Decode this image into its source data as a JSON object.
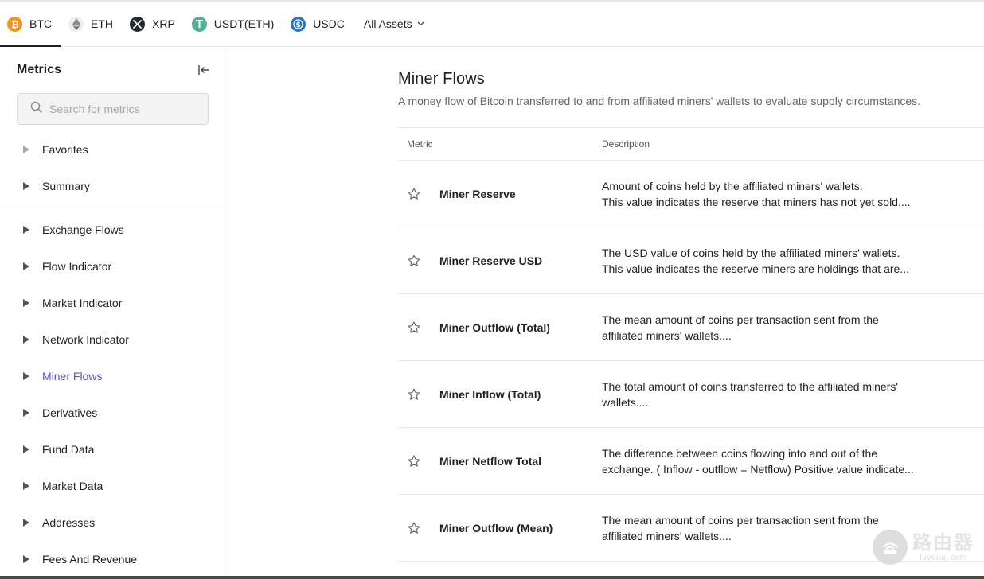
{
  "assets": [
    {
      "symbol": "BTC",
      "icon": "bitcoin-icon",
      "color": "#f7931a"
    },
    {
      "symbol": "ETH",
      "icon": "ethereum-icon",
      "color": "#8c8c8c"
    },
    {
      "symbol": "XRP",
      "icon": "xrp-icon",
      "color": "#23292f"
    },
    {
      "symbol": "USDT(ETH)",
      "icon": "tether-icon",
      "color": "#50af95"
    },
    {
      "symbol": "USDC",
      "icon": "usdc-icon",
      "color": "#2775ca"
    }
  ],
  "all_assets_label": "All Assets",
  "sidebar": {
    "title": "Metrics",
    "search_placeholder": "Search for metrics",
    "top_items": [
      {
        "label": "Favorites"
      },
      {
        "label": "Summary"
      }
    ],
    "items": [
      {
        "label": "Exchange Flows"
      },
      {
        "label": "Flow Indicator"
      },
      {
        "label": "Market Indicator"
      },
      {
        "label": "Network Indicator"
      },
      {
        "label": "Miner Flows"
      },
      {
        "label": "Derivatives"
      },
      {
        "label": "Fund Data"
      },
      {
        "label": "Market Data"
      },
      {
        "label": "Addresses"
      },
      {
        "label": "Fees And Revenue"
      }
    ],
    "active_item": "Miner Flows"
  },
  "main": {
    "title": "Miner Flows",
    "subtitle": "A money flow of Bitcoin transferred to and from affiliated miners' wallets to evaluate supply circumstances.",
    "columns": {
      "metric": "Metric",
      "description": "Description"
    },
    "rows": [
      {
        "name": "Miner Reserve",
        "desc_line1": "Amount of coins held by the affiliated miners' wallets.",
        "desc_line2": "This value indicates the reserve that miners has not yet sold...."
      },
      {
        "name": "Miner Reserve USD",
        "desc_line1": "The USD value of coins held by the affiliated miners' wallets.",
        "desc_line2": "This value indicates the reserve miners are holdings that are..."
      },
      {
        "name": "Miner Outflow (Total)",
        "desc_line1": "The mean amount of coins per transaction sent from the",
        "desc_line2": "affiliated miners' wallets...."
      },
      {
        "name": "Miner Inflow (Total)",
        "desc_line1": "The total amount of coins transferred to the affiliated miners'",
        "desc_line2": "wallets...."
      },
      {
        "name": "Miner Netflow Total",
        "desc_line1": "The difference between coins flowing into and out of the",
        "desc_line2": "exchange. ( Inflow - outflow = Netflow) Positive value indicate..."
      },
      {
        "name": "Miner Outflow (Mean)",
        "desc_line1": "The mean amount of coins per transaction sent from the",
        "desc_line2": "affiliated miners' wallets...."
      }
    ]
  },
  "watermark": {
    "cn": "路由器",
    "en": "luyouqi.com"
  },
  "colors": {
    "accent": "#5b4ed6"
  }
}
